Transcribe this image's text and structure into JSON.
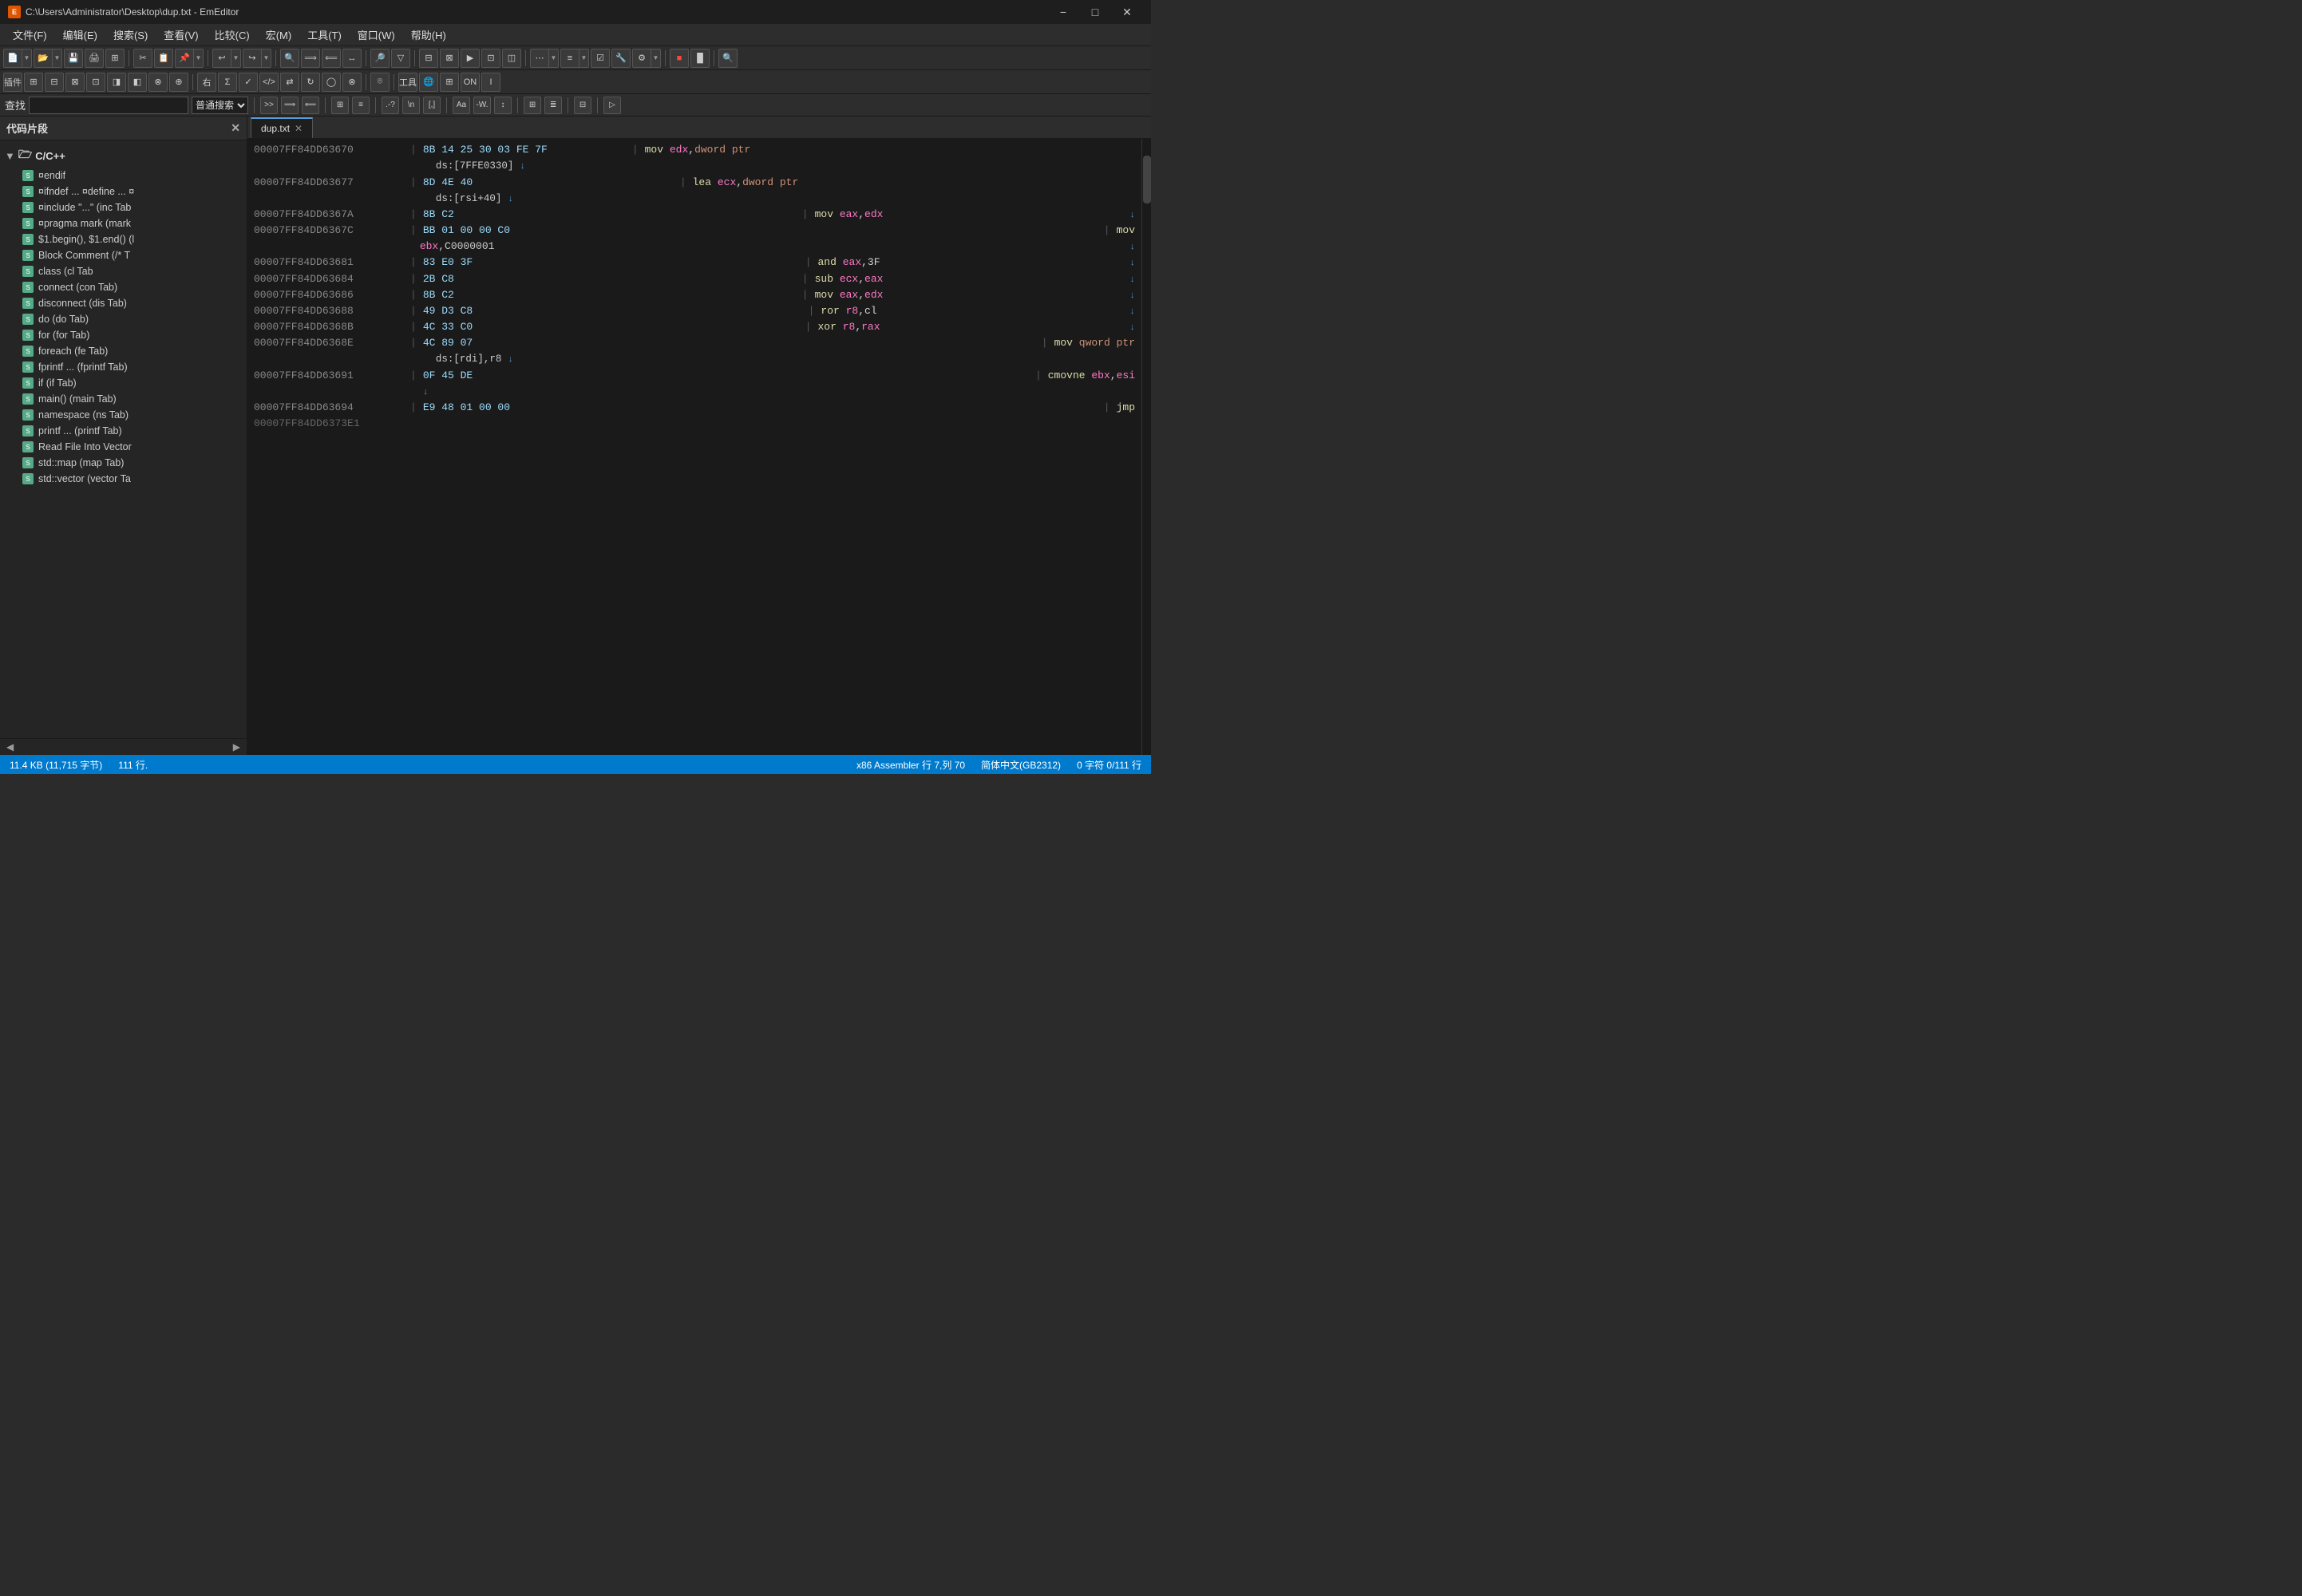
{
  "titlebar": {
    "title": "C:\\Users\\Administrator\\Desktop\\dup.txt - EmEditor",
    "app_name": "EmEditor",
    "app_icon": "E",
    "minimize": "−",
    "maximize": "□",
    "close": "✕"
  },
  "menubar": {
    "items": [
      {
        "label": "文件(F)"
      },
      {
        "label": "编辑(E)"
      },
      {
        "label": "搜索(S)"
      },
      {
        "label": "查看(V)"
      },
      {
        "label": "比较(C)"
      },
      {
        "label": "宏(M)"
      },
      {
        "label": "工具(T)"
      },
      {
        "label": "窗口(W)"
      },
      {
        "label": "帮助(H)"
      }
    ]
  },
  "search_bar": {
    "label": "查找",
    "placeholder": ""
  },
  "sidebar": {
    "title": "代码片段",
    "group": "C/C++",
    "items": [
      {
        "name": "¤endif"
      },
      {
        "name": "¤ifndef ... ¤define ... ¤"
      },
      {
        "name": "¤include \"...\" (inc Tab"
      },
      {
        "name": "¤pragma mark  (mark"
      },
      {
        "name": "$1.begin(), $1.end()  (l"
      },
      {
        "name": "Block Comment  (/* T"
      },
      {
        "name": "class  (cl Tab"
      },
      {
        "name": "connect  (con Tab)"
      },
      {
        "name": "disconnect  (dis Tab)"
      },
      {
        "name": "do  (do Tab)"
      },
      {
        "name": "for  (for Tab)"
      },
      {
        "name": "foreach  (fe Tab)"
      },
      {
        "name": "fprintf ...  (fprintf Tab)"
      },
      {
        "name": "if  (if Tab)"
      },
      {
        "name": "main()  (main Tab)"
      },
      {
        "name": "namespace  (ns Tab)"
      },
      {
        "name": "printf ...  (printf Tab)"
      },
      {
        "name": "Read File Into Vector"
      },
      {
        "name": "std::map  (map Tab)"
      },
      {
        "name": "std::vector  (vector Ta"
      }
    ]
  },
  "tabs": [
    {
      "label": "dup.txt",
      "active": true
    }
  ],
  "code": {
    "lines": [
      {
        "addr": "00007FF84DD63670",
        "hex": "8B 14 25 30 03 FE 7F",
        "instr": "mov",
        "args": "edx,dword ptr",
        "highlight_reg": "edx"
      },
      {
        "addr": "",
        "hex": "ds:[7FFE0330]",
        "instr": "",
        "args": "",
        "indent": true,
        "arrow": true
      },
      {
        "addr": "00007FF84DD63677",
        "hex": "8D 4E 40",
        "instr": "lea",
        "args": "ecx,dword ptr",
        "highlight_reg": "ecx"
      },
      {
        "addr": "",
        "hex": "ds:[rsi+40]",
        "instr": "",
        "args": "",
        "indent": true,
        "arrow": true
      },
      {
        "addr": "00007FF84DD6367A",
        "hex": "8B C2",
        "instr": "mov",
        "args": "eax,edx",
        "highlight_reg1": "eax",
        "highlight_reg2": "edx",
        "arrow": true
      },
      {
        "addr": "00007FF84DD6367C",
        "hex": "BB 01 00 00 C0",
        "instr": "mov",
        "args": ""
      },
      {
        "addr": "",
        "hex": "",
        "instr": "",
        "args": "ebx,C0000001",
        "is_ebx": true,
        "indent2": true,
        "arrow": true
      },
      {
        "addr": "00007FF84DD63681",
        "hex": "83 E0 3F",
        "instr": "and",
        "args": "eax,3F",
        "arrow": true
      },
      {
        "addr": "00007FF84DD63684",
        "hex": "2B C8",
        "instr": "sub",
        "args": "ecx,eax",
        "highlight_reg1": "ecx",
        "highlight_reg2": "eax",
        "arrow": true
      },
      {
        "addr": "00007FF84DD63686",
        "hex": "8B C2",
        "instr": "mov",
        "args": "eax,edx",
        "highlight_reg1": "eax",
        "highlight_reg2": "edx",
        "arrow": true
      },
      {
        "addr": "00007FF84DD63688",
        "hex": "49 D3 C8",
        "instr": "ror",
        "args": "r8,cl",
        "highlight_reg": "r8",
        "arrow": true
      },
      {
        "addr": "00007FF84DD6368B",
        "hex": "4C 33 C0",
        "instr": "xor",
        "args": "r8,rax",
        "highlight_reg1": "r8",
        "highlight_reg2": "rax",
        "arrow": true
      },
      {
        "addr": "00007FF84DD6368E",
        "hex": "4C 89 07",
        "instr": "mov",
        "args": "qword ptr"
      },
      {
        "addr": "",
        "hex": "ds:[rdi],r8",
        "instr": "",
        "args": "",
        "indent": true,
        "arrow": true
      },
      {
        "addr": "00007FF84DD63691",
        "hex": "0F 45 DE",
        "instr": "cmovne",
        "args": "ebx,esi",
        "highlight_reg1": "ebx",
        "highlight_reg2": "esi"
      },
      {
        "addr": "",
        "hex": "",
        "instr": "",
        "args": "",
        "arrow_only": true
      },
      {
        "addr": "00007FF84DD63694",
        "hex": "E9 48 01 00 00",
        "instr": "jmp",
        "args": ""
      }
    ]
  },
  "statusbar": {
    "file_size": "11.4 KB (11,715 字节)",
    "lines": "111 行.",
    "position": "x86 Assembler  行 7,列 70",
    "encoding": "简体中文(GB2312)",
    "selection": "0 字符  0/111 行"
  }
}
